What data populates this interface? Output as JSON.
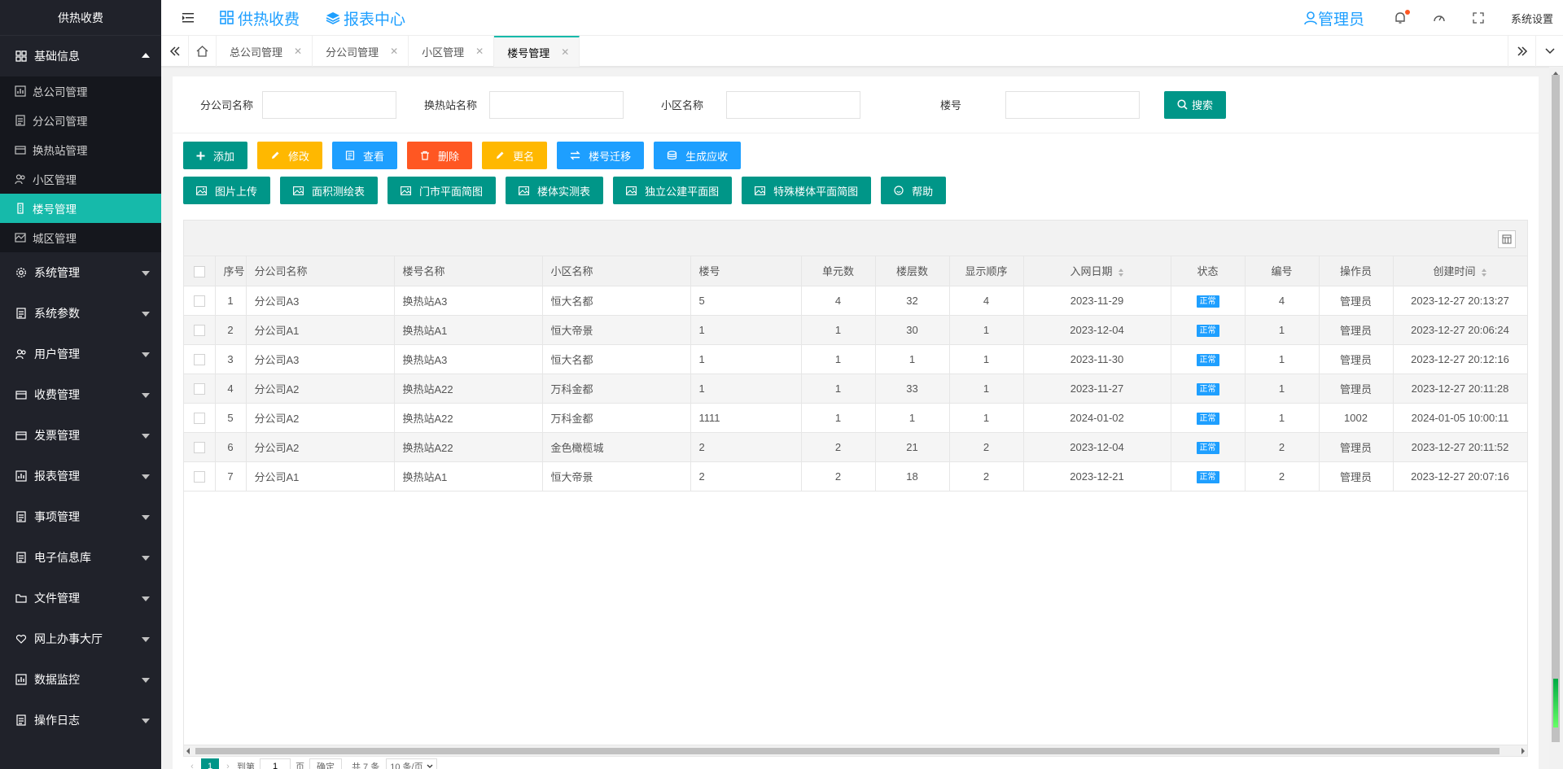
{
  "app": {
    "title": "供热收费"
  },
  "sidebar": {
    "groups": [
      {
        "label": "基础信息",
        "expanded": true,
        "items": [
          {
            "label": "总公司管理"
          },
          {
            "label": "分公司管理"
          },
          {
            "label": "换热站管理"
          },
          {
            "label": "小区管理"
          },
          {
            "label": "楼号管理",
            "active": true
          },
          {
            "label": "城区管理"
          }
        ]
      },
      {
        "label": "系统管理"
      },
      {
        "label": "系统参数"
      },
      {
        "label": "用户管理"
      },
      {
        "label": "收费管理"
      },
      {
        "label": "发票管理"
      },
      {
        "label": "报表管理"
      },
      {
        "label": "事项管理"
      },
      {
        "label": "电子信息库"
      },
      {
        "label": "文件管理"
      },
      {
        "label": "网上办事大厅"
      },
      {
        "label": "数据监控"
      },
      {
        "label": "操作日志"
      }
    ]
  },
  "header": {
    "nav1": "供热收费",
    "nav2": "报表中心",
    "user": "管理员",
    "settings": "系统设置"
  },
  "tabs": [
    {
      "label": "总公司管理"
    },
    {
      "label": "分公司管理"
    },
    {
      "label": "小区管理"
    },
    {
      "label": "楼号管理",
      "active": true
    }
  ],
  "search": {
    "f1_label": "分公司名称",
    "f2_label": "换热站名称",
    "f3_label": "小区名称",
    "f4_label": "楼号",
    "f1_value": "",
    "f2_value": "",
    "f3_value": "",
    "f4_value": "",
    "button": "搜索"
  },
  "toolbar": {
    "row1": [
      {
        "label": "添加",
        "color": "#009688",
        "icon": "plus-icon"
      },
      {
        "label": "修改",
        "color": "#ffb800",
        "icon": "edit-icon"
      },
      {
        "label": "查看",
        "color": "#1e9fff",
        "icon": "view-icon"
      },
      {
        "label": "删除",
        "color": "#ff5722",
        "icon": "trash-icon"
      },
      {
        "label": "更名",
        "color": "#ffb800",
        "icon": "edit-icon"
      },
      {
        "label": "楼号迁移",
        "color": "#1e9fff",
        "icon": "transfer-icon"
      },
      {
        "label": "生成应收",
        "color": "#1e9fff",
        "icon": "coins-icon"
      }
    ],
    "row2": [
      {
        "label": "图片上传",
        "icon": "image-icon"
      },
      {
        "label": "面积测绘表",
        "icon": "image-icon"
      },
      {
        "label": "门市平面简图",
        "icon": "image-icon"
      },
      {
        "label": "楼体实测表",
        "icon": "image-icon"
      },
      {
        "label": "独立公建平面图",
        "icon": "image-icon"
      },
      {
        "label": "特殊楼体平面简图",
        "icon": "image-icon"
      },
      {
        "label": "帮助",
        "icon": "smile-icon"
      }
    ]
  },
  "table": {
    "columns": [
      "序号",
      "分公司名称",
      "楼号名称",
      "小区名称",
      "楼号",
      "单元数",
      "楼层数",
      "显示顺序",
      "入网日期",
      "状态",
      "编号",
      "操作员",
      "创建时间"
    ],
    "rows": [
      [
        "1",
        "分公司A3",
        "换热站A3",
        "恒大名都",
        "5",
        "4",
        "32",
        "4",
        "2023-11-29",
        "正常",
        "4",
        "管理员",
        "2023-12-27 20:13:27"
      ],
      [
        "2",
        "分公司A1",
        "换热站A1",
        "恒大帝景",
        "1",
        "1",
        "30",
        "1",
        "2023-12-04",
        "正常",
        "1",
        "管理员",
        "2023-12-27 20:06:24"
      ],
      [
        "3",
        "分公司A3",
        "换热站A3",
        "恒大名都",
        "1",
        "1",
        "1",
        "1",
        "2023-11-30",
        "正常",
        "1",
        "管理员",
        "2023-12-27 20:12:16"
      ],
      [
        "4",
        "分公司A2",
        "换热站A22",
        "万科金都",
        "1",
        "1",
        "33",
        "1",
        "2023-11-27",
        "正常",
        "1",
        "管理员",
        "2023-12-27 20:11:28"
      ],
      [
        "5",
        "分公司A2",
        "换热站A22",
        "万科金都",
        "1111",
        "1",
        "1",
        "1",
        "2024-01-02",
        "正常",
        "1",
        "1002",
        "2024-01-05 10:00:11"
      ],
      [
        "6",
        "分公司A2",
        "换热站A22",
        "金色橄榄城",
        "2",
        "2",
        "21",
        "2",
        "2023-12-04",
        "正常",
        "2",
        "管理员",
        "2023-12-27 20:11:52"
      ],
      [
        "7",
        "分公司A1",
        "换热站A1",
        "恒大帝景",
        "2",
        "2",
        "18",
        "2",
        "2023-12-21",
        "正常",
        "2",
        "管理员",
        "2023-12-27 20:07:16"
      ]
    ]
  },
  "pager": {
    "current": "1",
    "goto_label": "到第",
    "page_input": "1",
    "page_unit": "页",
    "confirm": "确定",
    "total": "共 7 条",
    "page_size": "10 条/页"
  }
}
